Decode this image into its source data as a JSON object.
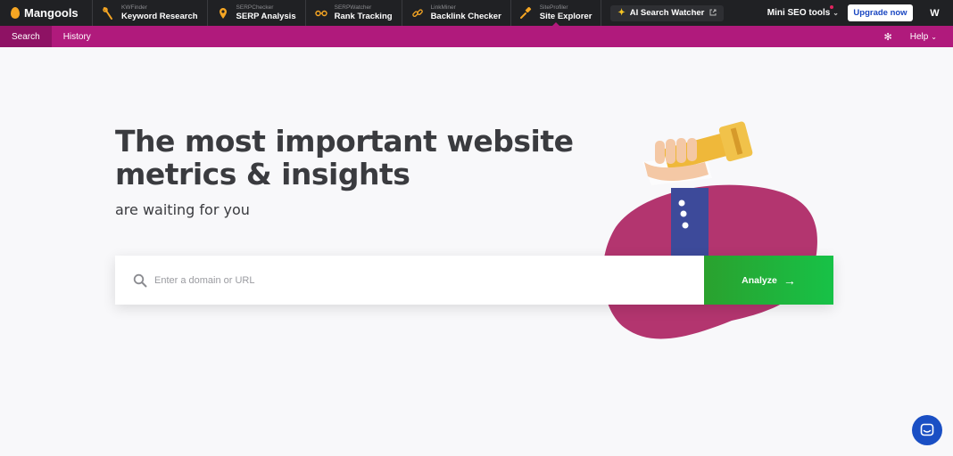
{
  "brand": {
    "name": "Mangools"
  },
  "tools": [
    {
      "small": "KWFinder",
      "label": "Keyword Research",
      "icon": "kwfinder-icon"
    },
    {
      "small": "SERPChecker",
      "label": "SERP Analysis",
      "icon": "serpchecker-icon"
    },
    {
      "small": "SERPWatcher",
      "label": "Rank Tracking",
      "icon": "serpwatcher-icon"
    },
    {
      "small": "LinkMiner",
      "label": "Backlink Checker",
      "icon": "linkminer-icon"
    },
    {
      "small": "SiteProfiler",
      "label": "Site Explorer",
      "icon": "siteprofiler-icon",
      "active": true
    }
  ],
  "ai_watcher": {
    "label": "AI Search Watcher"
  },
  "topright": {
    "mini_tools": "Mini SEO tools",
    "upgrade": "Upgrade now",
    "avatar": "W"
  },
  "subnav": {
    "tabs": [
      "Search",
      "History"
    ],
    "active": "Search",
    "help": "Help"
  },
  "hero": {
    "title_line1": "The most important website",
    "title_line2": "metrics & insights",
    "subtitle": "are waiting for you"
  },
  "search": {
    "placeholder": "Enter a domain or URL",
    "value": "",
    "button": "Analyze"
  },
  "colors": {
    "topbar": "#202124",
    "accent": "#b01a7c",
    "button": "#17c247",
    "chat": "#1a4fc4"
  }
}
